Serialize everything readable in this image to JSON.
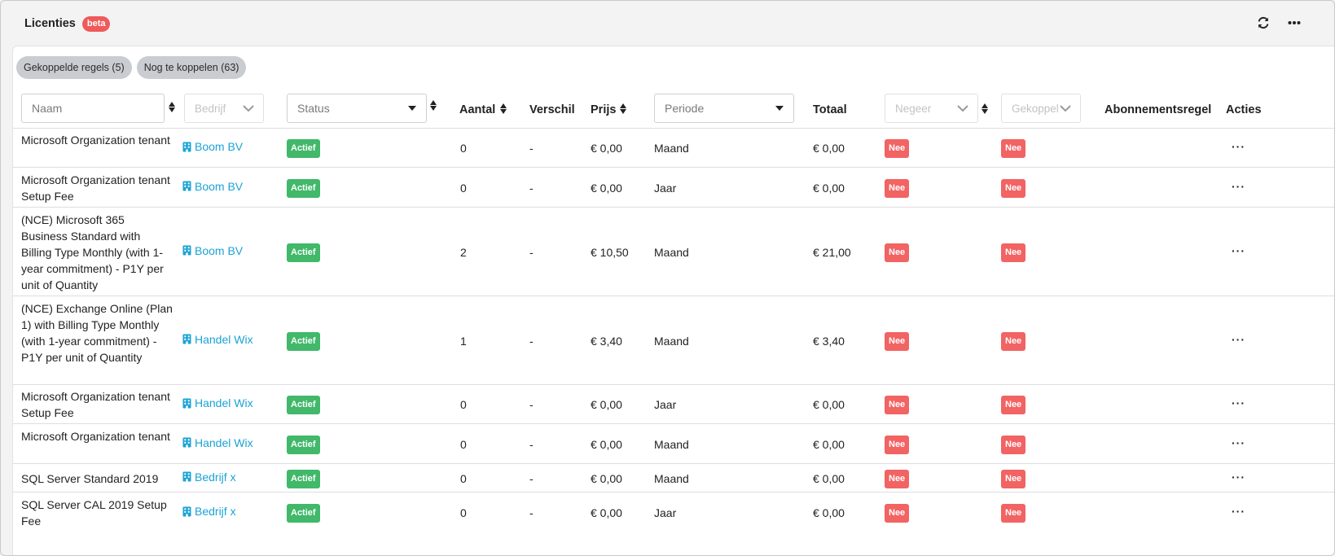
{
  "header": {
    "title": "Licenties",
    "badge": "beta",
    "icons": [
      "refresh-icon",
      "more-icon"
    ]
  },
  "tabs": [
    {
      "label": "Gekoppelde regels (5)"
    },
    {
      "label": "Nog te koppelen (63)"
    }
  ],
  "filters": {
    "naam_placeholder": "Naam",
    "bedrijf_placeholder": "Bedrijf",
    "status_placeholder": "Status",
    "periode_placeholder": "Periode",
    "negeer_placeholder": "Negeer",
    "gekoppeld_placeholder": "Gekoppel"
  },
  "columns": {
    "aantal": "Aantal",
    "verschil": "Verschil",
    "prijs": "Prijs",
    "totaal": "Totaal",
    "abonnementsregel": "Abonnementsregel",
    "acties": "Acties"
  },
  "colors": {
    "accent": "#1aa3d5",
    "status_green": "#41b86a",
    "flag_red": "#f26363"
  },
  "rows": [
    {
      "name": "Microsoft Organization tenant",
      "company": "Boom BV",
      "status": "Actief",
      "aantal": "0",
      "verschil": "-",
      "prijs": "€ 0,00",
      "periode": "Maand",
      "totaal": "€ 0,00",
      "negeer": "Nee",
      "gekoppeld": "Nee",
      "actions": "···"
    },
    {
      "name": "Microsoft Organization tenant Setup Fee",
      "company": "Boom BV",
      "status": "Actief",
      "aantal": "0",
      "verschil": "-",
      "prijs": "€ 0,00",
      "periode": "Jaar",
      "totaal": "€ 0,00",
      "negeer": "Nee",
      "gekoppeld": "Nee",
      "actions": "···"
    },
    {
      "name": "(NCE) Microsoft 365 Business Standard with Billing Type Monthly (with 1-year commitment) - P1Y per unit of Quantity",
      "company": "Boom BV",
      "status": "Actief",
      "aantal": "2",
      "verschil": "-",
      "prijs": "€ 10,50",
      "periode": "Maand",
      "totaal": "€ 21,00",
      "negeer": "Nee",
      "gekoppeld": "Nee",
      "actions": "···"
    },
    {
      "name": "(NCE) Exchange Online (Plan 1) with Billing Type Monthly (with 1-year commitment) - P1Y per unit of Quantity",
      "company": "Handel Wix",
      "status": "Actief",
      "aantal": "1",
      "verschil": "-",
      "prijs": "€ 3,40",
      "periode": "Maand",
      "totaal": "€ 3,40",
      "negeer": "Nee",
      "gekoppeld": "Nee",
      "actions": "···"
    },
    {
      "name": "Microsoft Organization tenant Setup Fee",
      "company": "Handel Wix",
      "status": "Actief",
      "aantal": "0",
      "verschil": "-",
      "prijs": "€ 0,00",
      "periode": "Jaar",
      "totaal": "€ 0,00",
      "negeer": "Nee",
      "gekoppeld": "Nee",
      "actions": "···"
    },
    {
      "name": "Microsoft Organization tenant",
      "company": "Handel Wix",
      "status": "Actief",
      "aantal": "0",
      "verschil": "-",
      "prijs": "€ 0,00",
      "periode": "Maand",
      "totaal": "€ 0,00",
      "negeer": "Nee",
      "gekoppeld": "Nee",
      "actions": "···"
    },
    {
      "name": "SQL Server Standard 2019",
      "company": "Bedrijf x",
      "status": "Actief",
      "aantal": "0",
      "verschil": "-",
      "prijs": "€ 0,00",
      "periode": "Maand",
      "totaal": "€ 0,00",
      "negeer": "Nee",
      "gekoppeld": "Nee",
      "actions": "···"
    },
    {
      "name": "SQL Server CAL 2019 Setup Fee",
      "company": "Bedrijf x",
      "status": "Actief",
      "aantal": "0",
      "verschil": "-",
      "prijs": "€ 0,00",
      "periode": "Jaar",
      "totaal": "€ 0,00",
      "negeer": "Nee",
      "gekoppeld": "Nee",
      "actions": "···"
    }
  ]
}
